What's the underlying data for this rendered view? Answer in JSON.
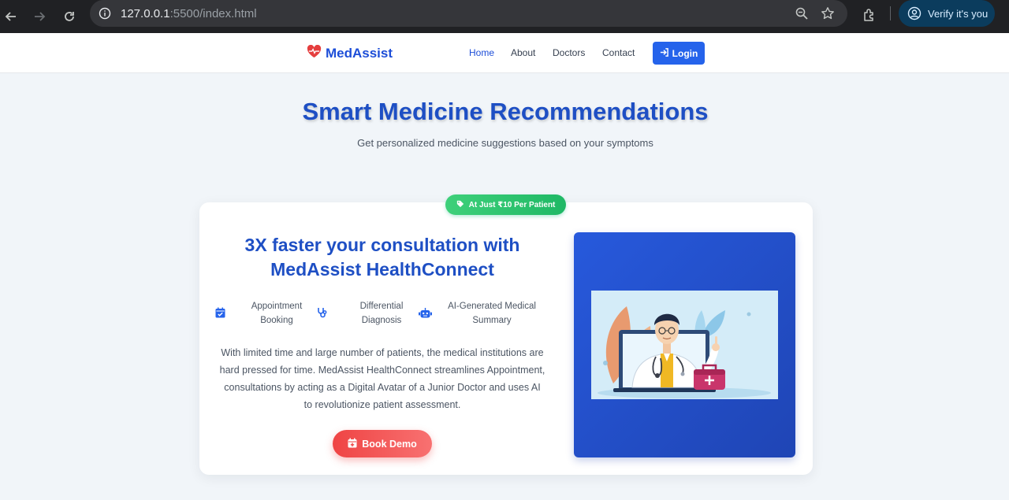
{
  "browser": {
    "url_host": "127.0.0.1",
    "url_rest": ":5500/index.html",
    "verify_label": "Verify it's you"
  },
  "header": {
    "brand": "MedAssist",
    "nav": [
      {
        "label": "Home"
      },
      {
        "label": "About"
      },
      {
        "label": "Doctors"
      },
      {
        "label": "Contact"
      }
    ],
    "login_label": "Login"
  },
  "hero": {
    "title": "Smart Medicine Recommendations",
    "subtitle": "Get personalized medicine suggestions based on your symptoms"
  },
  "card": {
    "badge": "At Just ₹10 Per Patient",
    "title_line1": "3X faster your consultation with",
    "title_line2": "MedAssist HealthConnect",
    "features": [
      {
        "line1": "Appointment",
        "line2": "Booking",
        "icon": "calendar-check-icon"
      },
      {
        "line1": "Differential",
        "line2": "Diagnosis",
        "icon": "stethoscope-icon"
      },
      {
        "line1": "AI-Generated Medical",
        "line2": "Summary",
        "icon": "robot-icon"
      }
    ],
    "description": "With limited time and large number of patients, the medical institutions are hard pressed for time. MedAssist HealthConnect streamlines Appointment, consultations by acting as a Digital Avatar of a Junior Doctor and uses AI to revolutionize patient assessment.",
    "cta_label": "Book Demo"
  },
  "colors": {
    "brand_blue": "#1d4ed8",
    "accent_green": "#22c55e",
    "cta_red": "#ef4444"
  }
}
